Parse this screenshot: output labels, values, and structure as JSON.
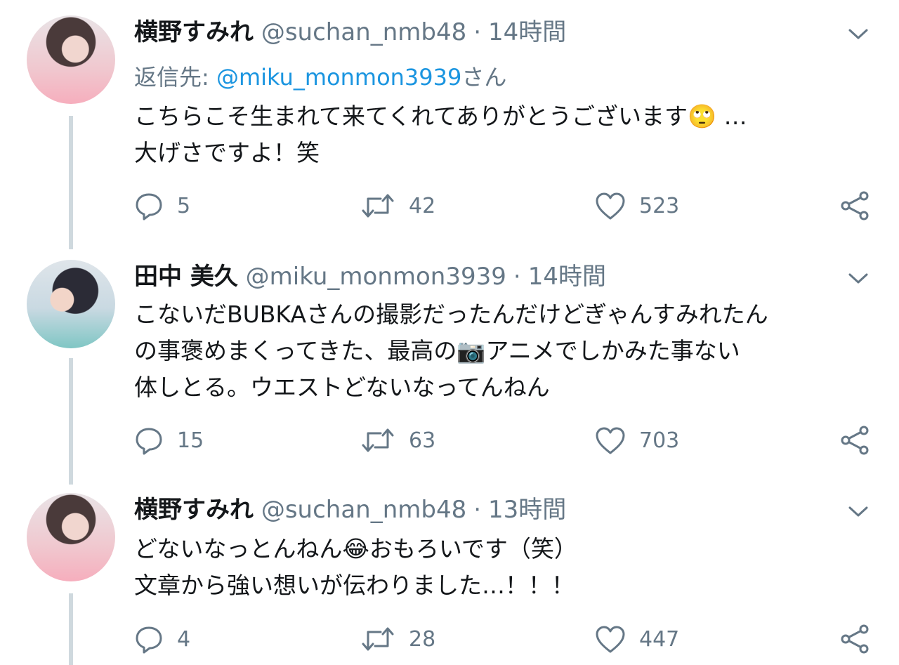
{
  "tweets": [
    {
      "name": "横野すみれ",
      "handle": "@suchan_nmb48",
      "separator": "·",
      "time": "14時間",
      "reply_to_label": "返信先: ",
      "reply_to_handle": "@miku_monmon3939",
      "reply_to_suffix": "さん",
      "lines": [
        "こちらこそ生まれて来てくれてありがとうございます🙄 …",
        "大げさですよ！笑"
      ],
      "replies": "5",
      "retweets": "42",
      "likes": "523"
    },
    {
      "name": "田中 美久",
      "handle": "@miku_monmon3939",
      "separator": "·",
      "time": "14時間",
      "lines": [
        "こないだBUBKAさんの撮影だったんだけどぎゃんすみれたん",
        "の事褒めまくってきた、最高の📷アニメでしかみた事ない",
        "体しとる。ウエストどないなってんねん"
      ],
      "replies": "15",
      "retweets": "63",
      "likes": "703"
    },
    {
      "name": "横野すみれ",
      "handle": "@suchan_nmb48",
      "separator": "·",
      "time": "13時間",
      "lines": [
        "どないなっとんねん😂おもろいです（笑）",
        "文章から強い想いが伝わりました…！！！"
      ],
      "replies": "4",
      "retweets": "28",
      "likes": "447"
    }
  ],
  "colors": {
    "text": "#14171a",
    "secondary": "#657786",
    "link": "#1b95e0",
    "thread_line": "#cfd9de"
  },
  "icons": [
    "chevron-down-icon",
    "reply-icon",
    "retweet-icon",
    "like-icon",
    "share-icon"
  ]
}
